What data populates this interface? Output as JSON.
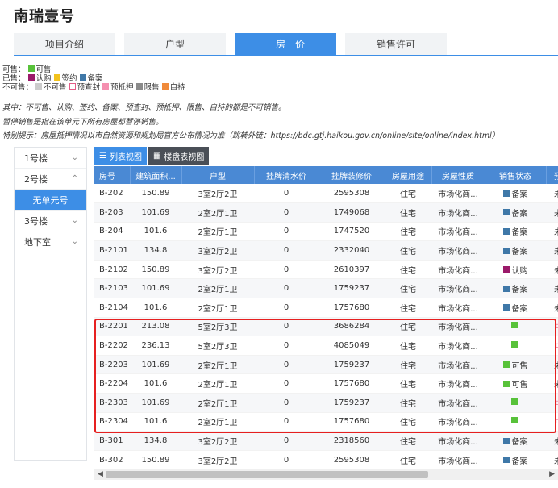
{
  "title": "南瑞壹号",
  "tabs": [
    "项目介绍",
    "户型",
    "一房一价",
    "销售许可"
  ],
  "legend": {
    "available_label": "可售：",
    "available_items": [
      {
        "name": "可售",
        "color": "#58c23a"
      }
    ],
    "sold_label": "已售：",
    "sold_items": [
      {
        "name": "认购",
        "color": "#9b1a6a"
      },
      {
        "name": "签约",
        "color": "#f2c21c"
      },
      {
        "name": "备案",
        "color": "#3f78a8"
      }
    ],
    "unavailable_label": "不可售：",
    "unavailable_items": [
      {
        "name": "不可售",
        "color": "#cccccc",
        "outline": false
      },
      {
        "name": "预查封",
        "color": "#e55d87",
        "outline": true
      },
      {
        "name": "预抵押",
        "color": "#f590b0",
        "outline": false
      },
      {
        "name": "限售",
        "color": "#8a8a8a",
        "outline": false
      },
      {
        "name": "自持",
        "color": "#f08a3a",
        "outline": false
      }
    ]
  },
  "notes": {
    "note1": "其中：不可售、认购、签约、备案、预查封、预抵押、限售、自持的都是不可销售。",
    "note2": "暂停销售是指在该单元下所有房屋都暂停销售。",
    "note3": "特别提示：房屋抵押情况以市自然资源和规划局官方公布情况为准（跳转外链：https://bdc.gtj.haikou.gov.cn/online/site/online/index.html）"
  },
  "sidebar": {
    "items": [
      {
        "label": "1号楼",
        "chevron": "⌄"
      },
      {
        "label": "2号楼",
        "chevron": "⌃"
      },
      {
        "label": "无单元号",
        "chevron": ""
      },
      {
        "label": "3号楼",
        "chevron": "⌄"
      },
      {
        "label": "地下室",
        "chevron": "⌄"
      }
    ]
  },
  "views": {
    "list": "列表视图",
    "floor": "楼盘表视图"
  },
  "table": {
    "headers": [
      "房号",
      "建筑面积...",
      "户型",
      "挂牌清水价",
      "挂牌装修价",
      "房屋用途",
      "房屋性质",
      "销售状态",
      "预"
    ],
    "rows": [
      {
        "room": "B-202",
        "area": "150.89",
        "type": "3室2厅2卫",
        "clear_price": "0",
        "deco_price": "2595308",
        "use": "住宅",
        "nature": "市场化商...",
        "status": "备案",
        "status_color": "#3f78a8",
        "extra": "未"
      },
      {
        "room": "B-203",
        "area": "101.69",
        "type": "2室2厅1卫",
        "clear_price": "0",
        "deco_price": "1749068",
        "use": "住宅",
        "nature": "市场化商...",
        "status": "备案",
        "status_color": "#3f78a8",
        "extra": "未"
      },
      {
        "room": "B-204",
        "area": "101.6",
        "type": "2室2厅1卫",
        "clear_price": "0",
        "deco_price": "1747520",
        "use": "住宅",
        "nature": "市场化商...",
        "status": "备案",
        "status_color": "#3f78a8",
        "extra": "未"
      },
      {
        "room": "B-2101",
        "area": "134.8",
        "type": "3室2厅2卫",
        "clear_price": "0",
        "deco_price": "2332040",
        "use": "住宅",
        "nature": "市场化商...",
        "status": "备案",
        "status_color": "#3f78a8",
        "extra": "未"
      },
      {
        "room": "B-2102",
        "area": "150.89",
        "type": "3室2厅2卫",
        "clear_price": "0",
        "deco_price": "2610397",
        "use": "住宅",
        "nature": "市场化商...",
        "status": "认购",
        "status_color": "#9b1a6a",
        "extra": "未"
      },
      {
        "room": "B-2103",
        "area": "101.69",
        "type": "2室2厅1卫",
        "clear_price": "0",
        "deco_price": "1759237",
        "use": "住宅",
        "nature": "市场化商...",
        "status": "备案",
        "status_color": "#3f78a8",
        "extra": "未"
      },
      {
        "room": "B-2104",
        "area": "101.6",
        "type": "2室2厅1卫",
        "clear_price": "0",
        "deco_price": "1757680",
        "use": "住宅",
        "nature": "市场化商...",
        "status": "备案",
        "status_color": "#3f78a8",
        "extra": "未"
      },
      {
        "room": "B-2201",
        "area": "213.08",
        "type": "5室2厅3卫",
        "clear_price": "0",
        "deco_price": "3686284",
        "use": "住宅",
        "nature": "市场化商...",
        "status": "",
        "status_color": "#58c23a",
        "extra": "▫"
      },
      {
        "room": "B-2202",
        "area": "236.13",
        "type": "5室2厅3卫",
        "clear_price": "0",
        "deco_price": "4085049",
        "use": "住宅",
        "nature": "市场化商...",
        "status": "",
        "status_color": "#58c23a",
        "extra": "▫"
      },
      {
        "room": "B-2203",
        "area": "101.69",
        "type": "2室2厅1卫",
        "clear_price": "0",
        "deco_price": "1759237",
        "use": "住宅",
        "nature": "市场化商...",
        "status": "可售",
        "status_color": "#58c23a",
        "extra": "未"
      },
      {
        "room": "B-2204",
        "area": "101.6",
        "type": "2室2厅1卫",
        "clear_price": "0",
        "deco_price": "1757680",
        "use": "住宅",
        "nature": "市场化商...",
        "status": "可售",
        "status_color": "#58c23a",
        "extra": "未"
      },
      {
        "room": "B-2303",
        "area": "101.69",
        "type": "2室2厅1卫",
        "clear_price": "0",
        "deco_price": "1759237",
        "use": "住宅",
        "nature": "市场化商...",
        "status": "",
        "status_color": "#58c23a",
        "extra": "▫"
      },
      {
        "room": "B-2304",
        "area": "101.6",
        "type": "2室2厅1卫",
        "clear_price": "0",
        "deco_price": "1757680",
        "use": "住宅",
        "nature": "市场化商...",
        "status": "",
        "status_color": "#58c23a",
        "extra": "▫"
      },
      {
        "room": "B-301",
        "area": "134.8",
        "type": "3室2厅2卫",
        "clear_price": "0",
        "deco_price": "2318560",
        "use": "住宅",
        "nature": "市场化商...",
        "status": "备案",
        "status_color": "#3f78a8",
        "extra": "未"
      },
      {
        "room": "B-302",
        "area": "150.89",
        "type": "3室2厅2卫",
        "clear_price": "0",
        "deco_price": "2595308",
        "use": "住宅",
        "nature": "市场化商...",
        "status": "备案",
        "status_color": "#3f78a8",
        "extra": "未"
      }
    ]
  }
}
